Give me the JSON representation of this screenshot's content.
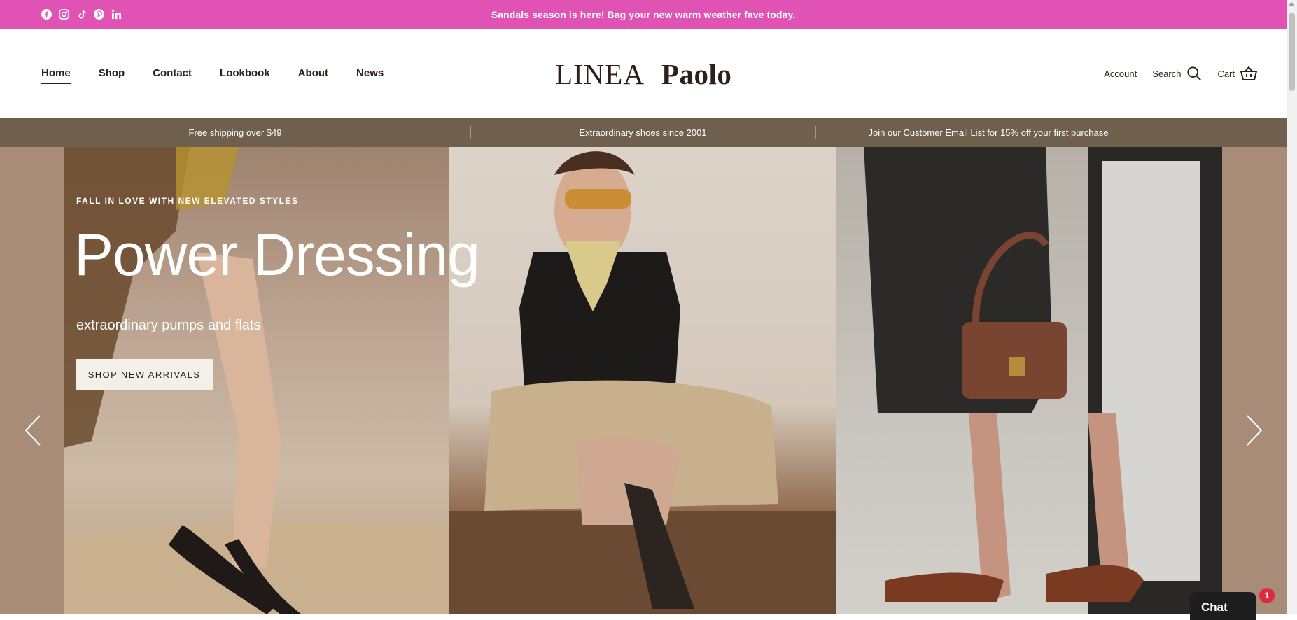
{
  "announcement": {
    "text": "Sandals season is here! Bag your new warm weather fave today.",
    "bg_color": "#e052b4",
    "social_icons": [
      "facebook-icon",
      "instagram-icon",
      "tiktok-icon",
      "pinterest-icon",
      "linkedin-icon"
    ]
  },
  "header": {
    "nav": [
      {
        "label": "Home",
        "active": true
      },
      {
        "label": "Shop"
      },
      {
        "label": "Contact"
      },
      {
        "label": "Lookbook"
      },
      {
        "label": "About"
      },
      {
        "label": "News"
      }
    ],
    "logo": {
      "left": "LINEA",
      "right": "Paolo"
    },
    "account_label": "Account",
    "search_label": "Search",
    "cart_label": "Cart"
  },
  "perks": [
    "Free shipping over $49",
    "Extraordinary shoes since 2001",
    "Join our Customer Email List for 15% off your first purchase"
  ],
  "hero": {
    "kicker": "FALL IN LOVE WITH NEW ELEVATED STYLES",
    "headline": "Power Dressing",
    "subline": "extraordinary pumps and flats",
    "cta": "SHOP NEW ARRIVALS"
  },
  "chat": {
    "label": "Chat",
    "badge": "1"
  },
  "colors": {
    "perks_bg": "#6f604d",
    "hero_bg": "#a88c77",
    "text": "#2b2118"
  }
}
